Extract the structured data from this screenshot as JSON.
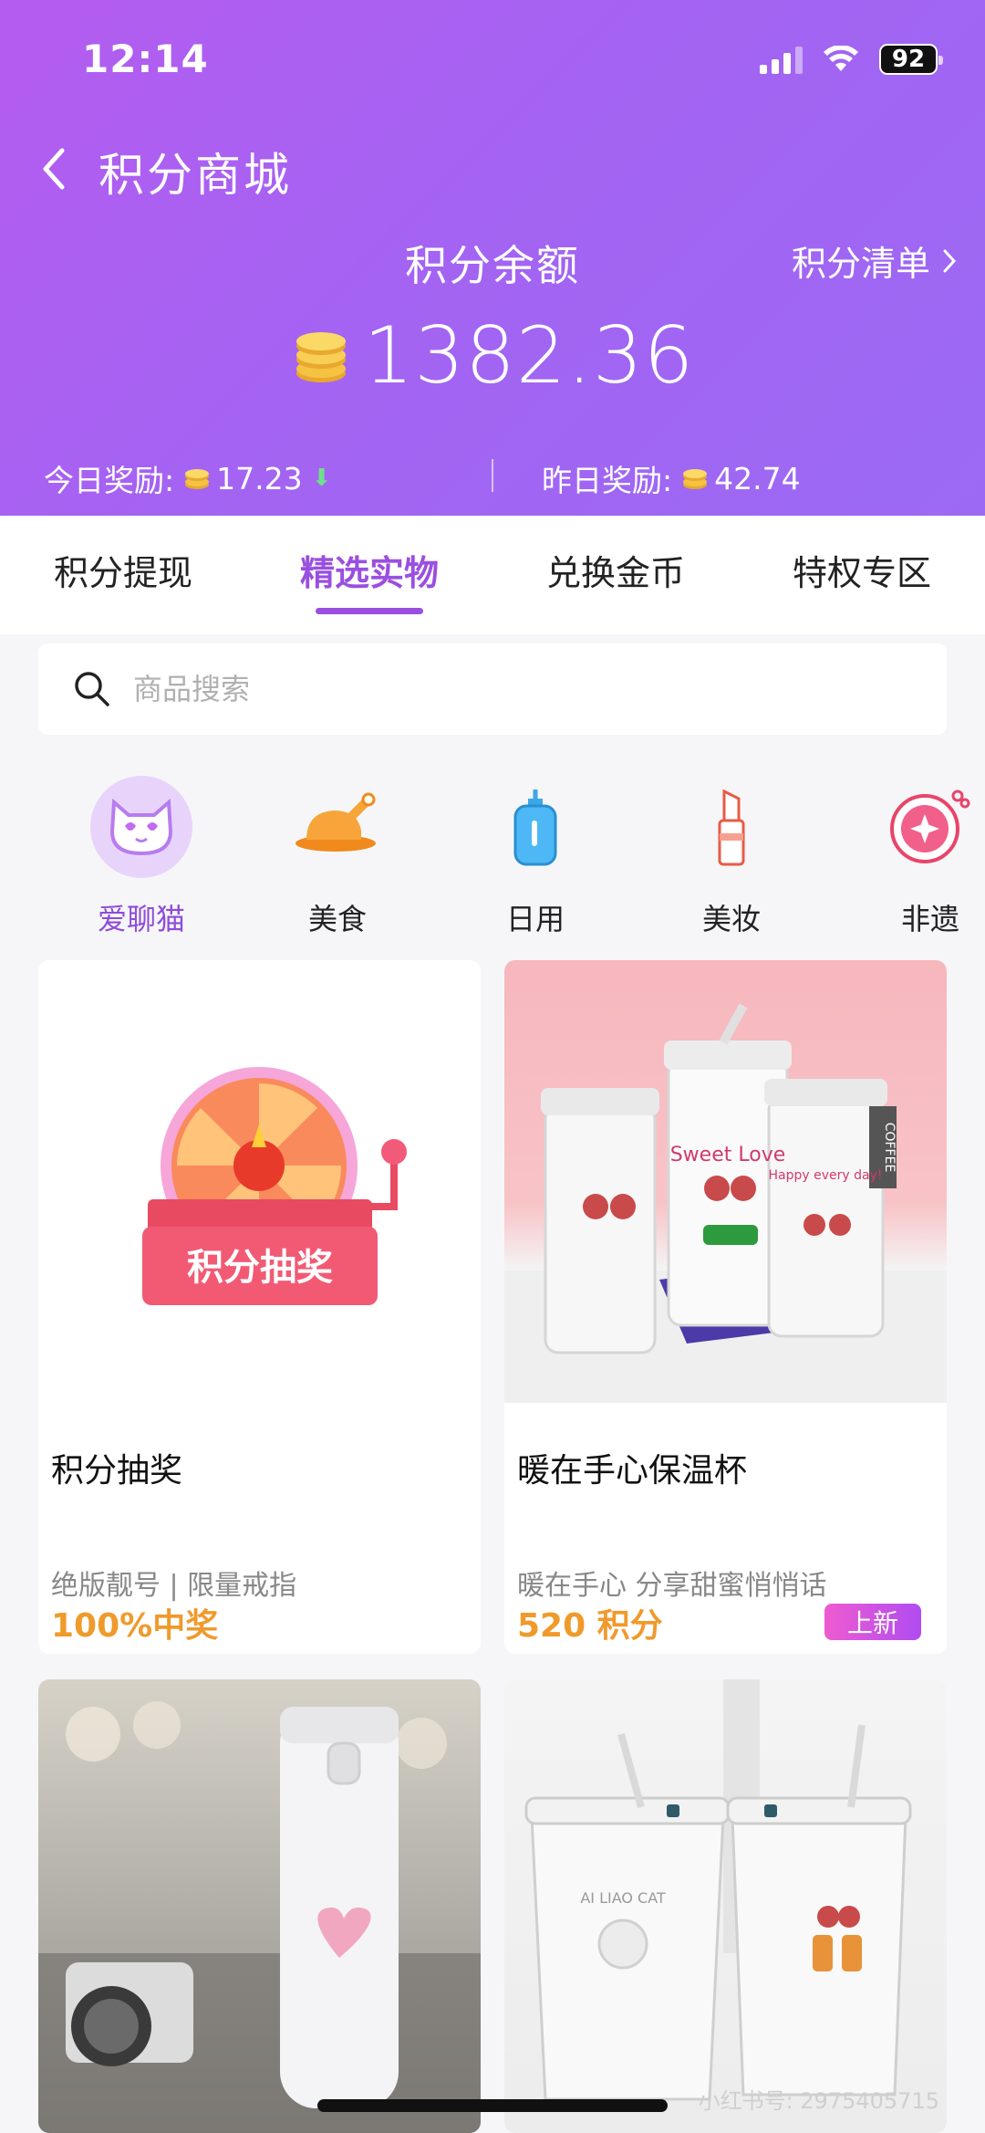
{
  "status_bar": {
    "time": "12:14",
    "battery": "92"
  },
  "header": {
    "title": "积分商城",
    "balance_label": "积分余额",
    "ledger_link": "积分清单",
    "balance": "1382.36",
    "today_label": "今日奖励:",
    "today_value": "17.23",
    "yesterday_label": "昨日奖励:",
    "yesterday_value": "42.74"
  },
  "tabs": [
    {
      "label": "积分提现"
    },
    {
      "label": "精选实物",
      "active": true
    },
    {
      "label": "兑换金币"
    },
    {
      "label": "特权专区"
    }
  ],
  "search": {
    "placeholder": "商品搜索"
  },
  "categories": [
    {
      "label": "爱聊猫",
      "icon": "cat-icon",
      "active": true
    },
    {
      "label": "美食",
      "icon": "roast-chicken-icon"
    },
    {
      "label": "日用",
      "icon": "bottle-icon"
    },
    {
      "label": "美妆",
      "icon": "lipstick-icon"
    },
    {
      "label": "非遗",
      "icon": "heritage-icon"
    }
  ],
  "products": [
    {
      "title": "积分抽奖",
      "subtitle": "绝版靓号 | 限量戒指",
      "price": "100%中奖",
      "banner_text": "积分抽奖"
    },
    {
      "title": "暖在手心保温杯",
      "subtitle": "暖在手心 分享甜蜜悄悄话",
      "price": "520 积分",
      "badge": "上新",
      "cup_labels": [
        "Sweet Love",
        "Happy every day!",
        "COFFEE"
      ]
    },
    {
      "title": "",
      "subtitle": "",
      "price": ""
    },
    {
      "title": "",
      "subtitle": "",
      "price": "",
      "cup_label": "AI LIAO CAT"
    }
  ],
  "watermark": "小红书号: 2975405715",
  "colors": {
    "accent": "#9a4fe0",
    "header_start": "#b45cf0",
    "header_end": "#9b6af4",
    "price": "#f09a2c",
    "coin": "#f5c242"
  }
}
